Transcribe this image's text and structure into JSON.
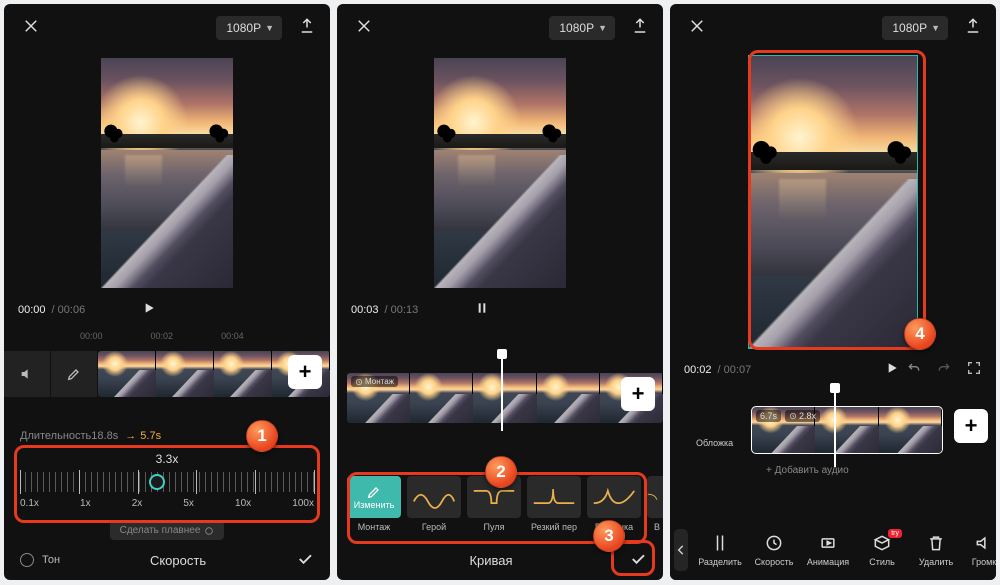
{
  "header": {
    "resolution": "1080P"
  },
  "panel1": {
    "current_time": "00:00",
    "total_time": "00:06",
    "ruler": [
      "00:00",
      "00:02",
      "00:04"
    ],
    "duration_label_prefix": "Длительность",
    "duration_old": "18.8s",
    "duration_new": "5.7s",
    "speed_value": "3.3x",
    "speed_stops": [
      "0.1x",
      "1x",
      "2x",
      "5x",
      "10x",
      "100x"
    ],
    "smooth_label": "Сделать плавнее",
    "tone_label": "Тон",
    "title": "Скорость",
    "badge": "1"
  },
  "panel2": {
    "current_time": "00:03",
    "total_time": "00:13",
    "montage_chip": "Монтаж",
    "edit_label": "Изменить",
    "curves": [
      "Монтаж",
      "Герой",
      "Пуля",
      "Резкий пер",
      "Вспышка",
      "В"
    ],
    "title": "Кривая",
    "badge_list": "2",
    "badge_check": "3"
  },
  "panel3": {
    "current_time": "00:02",
    "total_time": "00:07",
    "clip_duration": "6.7s",
    "clip_speed": "2.8x",
    "cover_label": "Обложка",
    "add_audio": "+ Добавить аудио",
    "tools": [
      "Разделить",
      "Скорость",
      "Анимация",
      "Стиль",
      "Удалить",
      "Громк"
    ],
    "style_badge": "try",
    "badge": "4"
  }
}
